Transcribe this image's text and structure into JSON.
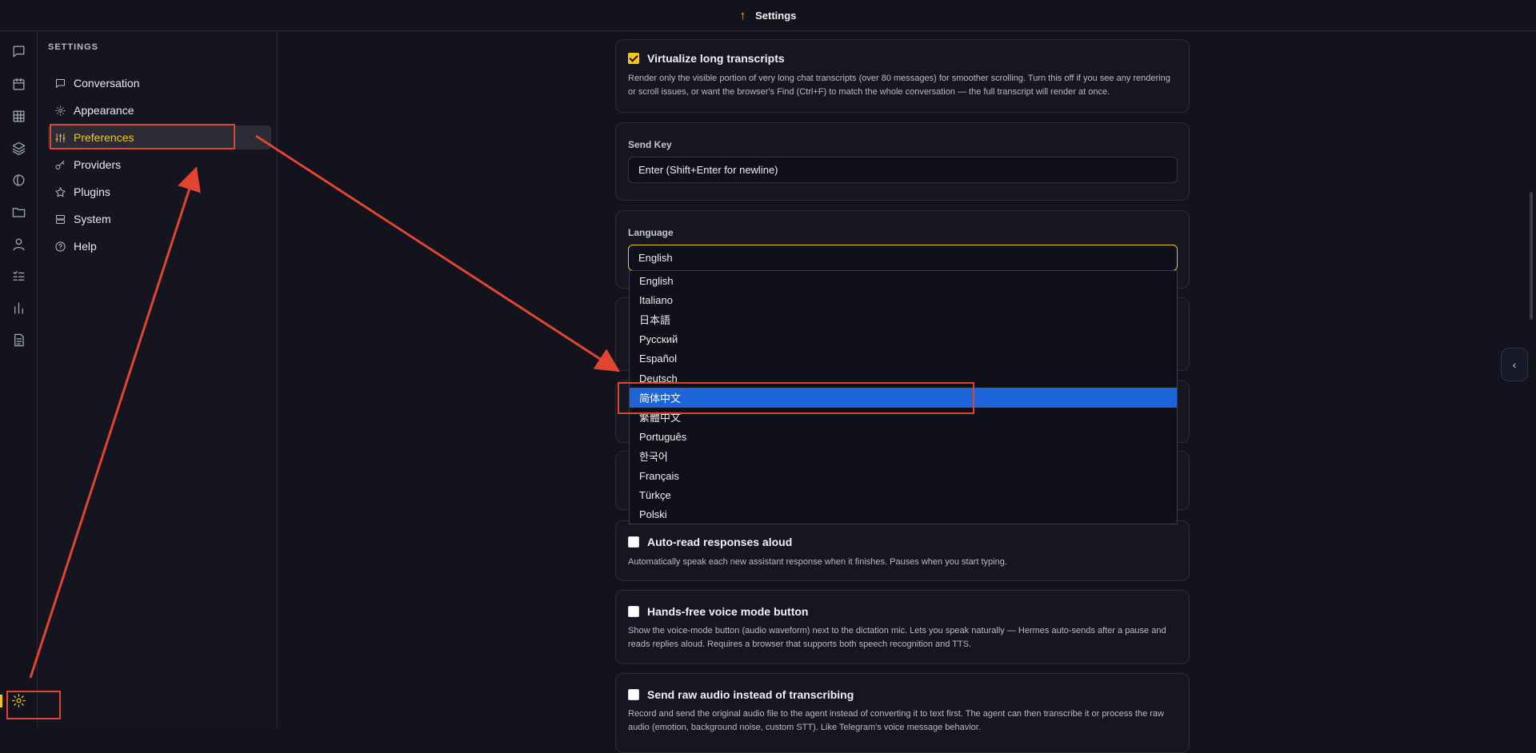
{
  "topbar": {
    "icon": "arrow-up-icon",
    "title": "Settings"
  },
  "rail": {
    "items": [
      "chat-icon",
      "calendar-icon",
      "grid-icon",
      "layers-icon",
      "globe-icon",
      "folder-icon",
      "user-icon",
      "checklist-icon",
      "bar-chart-icon",
      "document-icon"
    ],
    "bottom": "gear-icon"
  },
  "sidebar": {
    "heading": "SETTINGS",
    "items": [
      {
        "label": "Conversation",
        "icon": "chat-icon"
      },
      {
        "label": "Appearance",
        "icon": "sun-icon"
      },
      {
        "label": "Preferences",
        "icon": "sliders-icon",
        "active": true
      },
      {
        "label": "Providers",
        "icon": "key-icon"
      },
      {
        "label": "Plugins",
        "icon": "star-icon"
      },
      {
        "label": "System",
        "icon": "server-icon"
      },
      {
        "label": "Help",
        "icon": "help-icon"
      }
    ]
  },
  "settings": {
    "virtualize": {
      "title": "Virtualize long transcripts",
      "checked": true,
      "desc": "Render only the visible portion of very long chat transcripts (over 80 messages) for smoother scrolling. Turn this off if you see any rendering or scroll issues, or want the browser's Find (Ctrl+F) to match the whole conversation — the full transcript will render at once."
    },
    "send_key": {
      "label": "Send Key",
      "value": "Enter (Shift+Enter for newline)"
    },
    "language": {
      "label": "Language",
      "value": "English",
      "options": [
        "English",
        "Italiano",
        "日本語",
        "Русский",
        "Español",
        "Deutsch",
        "简体中文",
        "繁體中文",
        "Português",
        "한국어",
        "Français",
        "Türkçe",
        "Polski"
      ],
      "highlighted": "简体中文"
    },
    "auto_read": {
      "title": "Auto-read responses aloud",
      "checked": false,
      "desc": "Automatically speak each new assistant response when it finishes. Pauses when you start typing."
    },
    "hands_free": {
      "title": "Hands-free voice mode button",
      "checked": false,
      "desc": "Show the voice-mode button (audio waveform) next to the dictation mic. Lets you speak naturally — Hermes auto-sends after a pause and reads replies aloud. Requires a browser that supports both speech recognition and TTS."
    },
    "raw_audio": {
      "title": "Send raw audio instead of transcribing",
      "checked": false,
      "desc": "Record and send the original audio file to the agent instead of converting it to text first. The agent can then transcribe it or process the raw audio (emotion, background noise, custom STT). Like Telegram's voice message behavior."
    }
  },
  "collapse_button": {
    "icon": "chevron-left-icon",
    "glyph": "‹"
  },
  "colors": {
    "accent": "#f5c518",
    "selection": "#1c64d8",
    "annotation": "#e0452f",
    "background": "#12131d"
  }
}
